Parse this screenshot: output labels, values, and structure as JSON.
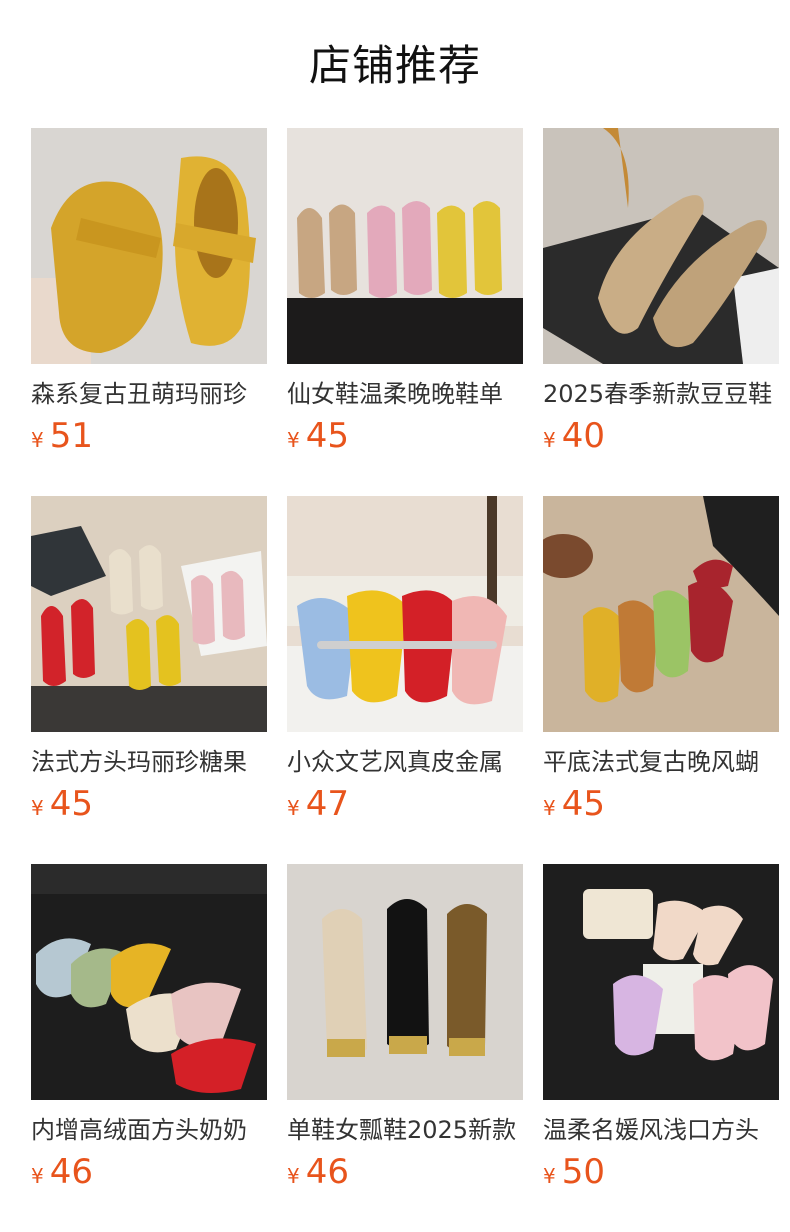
{
  "header": {
    "title": "店铺推荐"
  },
  "currency_symbol": "¥",
  "products": [
    {
      "name": "森系复古丑萌玛丽珍",
      "price": "51",
      "image": "yellow-velcro-mary-jane-shoes"
    },
    {
      "name": "仙女鞋温柔晚晚鞋单",
      "price": "45",
      "image": "three-pairs-bow-flats-on-shelf"
    },
    {
      "name": "2025春季新款豆豆鞋",
      "price": "40",
      "image": "beige-suede-loafers-on-box"
    },
    {
      "name": "法式方头玛丽珍糖果",
      "price": "45",
      "image": "colorful-bow-flats-on-table"
    },
    {
      "name": "小众文艺风真皮金属",
      "price": "47",
      "image": "mary-janes-with-metal-strap"
    },
    {
      "name": "平底法式复古晚风蝴",
      "price": "45",
      "image": "suede-bow-flats-on-rug"
    },
    {
      "name": "内增高绒面方头奶奶",
      "price": "46",
      "image": "pastel-bow-flats-on-black-leather"
    },
    {
      "name": "单鞋女瓢鞋2025新款",
      "price": "46",
      "image": "flats-with-metal-toe-cap"
    },
    {
      "name": "温柔名媛风浅口方头",
      "price": "50",
      "image": "pink-bow-flats-with-handbag"
    }
  ],
  "colors": {
    "price": "#e8541c",
    "title": "#111111",
    "name": "#333333"
  }
}
